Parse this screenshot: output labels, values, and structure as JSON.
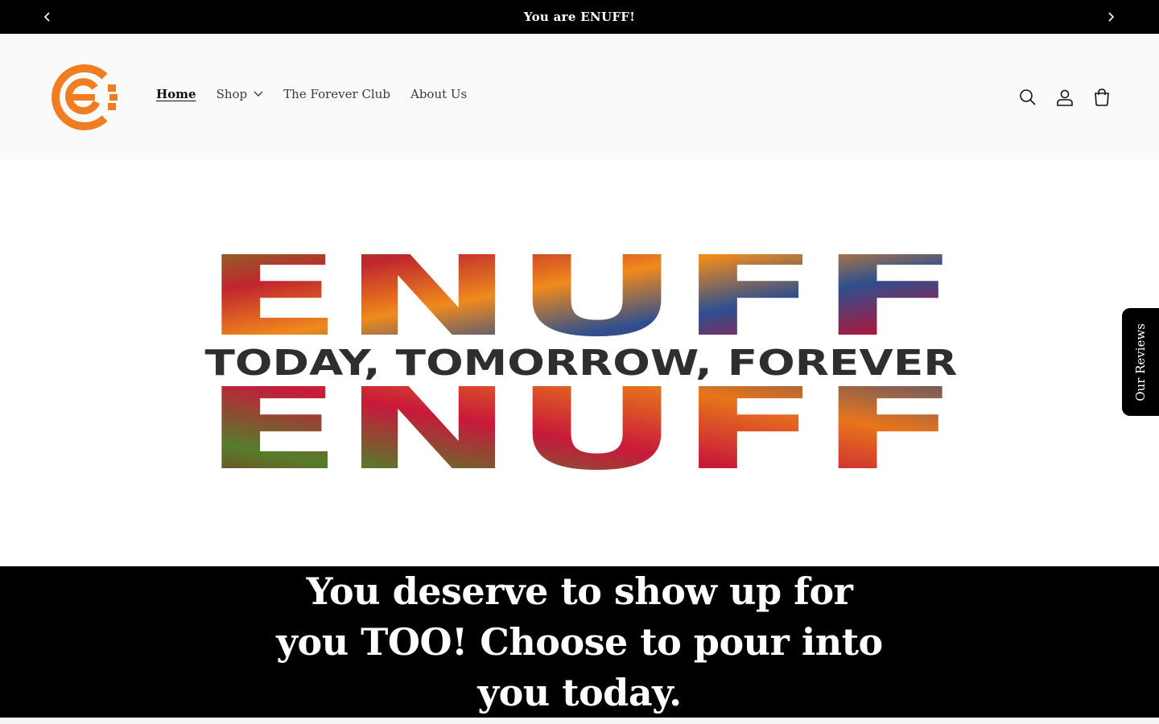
{
  "announcement": {
    "text": "You are ENUFF!",
    "prev_icon": "chevron-left-icon",
    "next_icon": "chevron-right-icon"
  },
  "header": {
    "logo": "enuff-e-logo",
    "nav": [
      {
        "label": "Home",
        "active": true
      },
      {
        "label": "Shop",
        "has_dropdown": true
      },
      {
        "label": "The Forever Club"
      },
      {
        "label": "About Us"
      }
    ],
    "icons": [
      "search-icon",
      "account-icon",
      "cart-icon"
    ]
  },
  "hero": {
    "word_top": "ENUFF",
    "word_bottom": "ENUFF",
    "tagline": "TODAY, TOMORROW, FOREVER"
  },
  "reviews_tab": {
    "label": "Our Reviews"
  },
  "statement": {
    "heading": "You deserve to show up for you TOO! Choose to pour into you today."
  },
  "colors": {
    "brand_orange": "#f07d22",
    "black": "#000000",
    "header_bg": "#fafafa"
  }
}
